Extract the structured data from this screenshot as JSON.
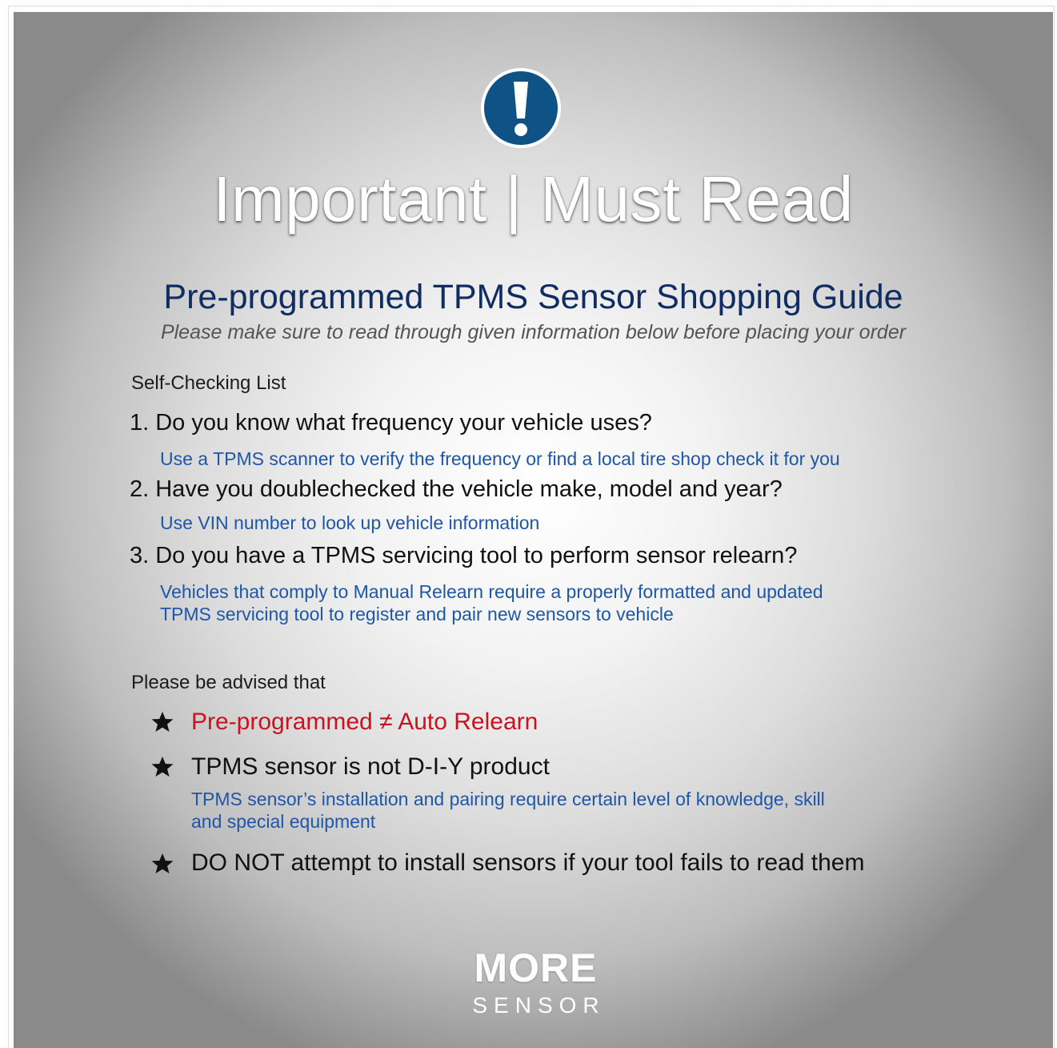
{
  "header": {
    "icon": "exclamation-icon",
    "headline": "Important | Must Read"
  },
  "guide": {
    "title": "Pre-programmed TPMS Sensor Shopping Guide",
    "subtitle": "Please make sure to read through given information below before placing your order"
  },
  "checklist": {
    "label": "Self-Checking List",
    "items": [
      {
        "question": "1. Do you know what frequency your vehicle uses?",
        "hint_lines": [
          "Use a TPMS scanner to verify the frequency or find a local tire shop check it for you"
        ]
      },
      {
        "question": "2. Have you doublechecked the vehicle make, model and year?",
        "hint_lines": [
          "Use VIN number to look up vehicle information"
        ]
      },
      {
        "question": "3. Do you have a TPMS servicing tool to perform sensor relearn?",
        "hint_lines": [
          "Vehicles that comply to Manual Relearn require a properly formatted and updated",
          "TPMS servicing tool to register and pair new sensors to vehicle"
        ]
      }
    ]
  },
  "advisory": {
    "label": "Please be advised that",
    "bullets": [
      {
        "text": "Pre-programmed ≠ Auto Relearn",
        "icon": "star-icon",
        "color": "#c8141e",
        "hint_lines": []
      },
      {
        "text": "TPMS sensor is not D-I-Y product",
        "icon": "star-icon",
        "hint_lines": [
          "TPMS sensor’s installation and pairing require certain level of knowledge, skill",
          "and special equipment"
        ]
      },
      {
        "text": "DO NOT attempt to install sensors if your tool fails to read them",
        "icon": "star-icon",
        "hint_lines": []
      }
    ]
  },
  "brand": {
    "word": "MORE",
    "sub": "SENSOR"
  },
  "colors": {
    "icon_blue": "#0f5285",
    "title_navy": "#0f2c63",
    "hint_blue": "#1e56a8",
    "alert_red": "#c8141e"
  }
}
